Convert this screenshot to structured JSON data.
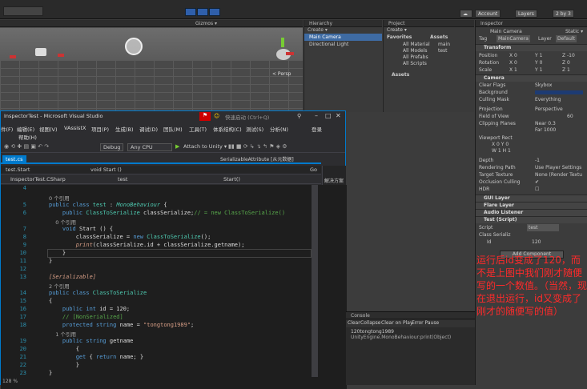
{
  "unity": {
    "layout_btn": "Account",
    "layers_btn": "Layers",
    "layout2_btn": "2 by 3",
    "scene": {
      "gizmos": "Gizmos ▾",
      "persp": "< Persp"
    },
    "hierarchy": {
      "title": "Hierarchy",
      "create": "Create ▾",
      "items": [
        "Main Camera",
        "Directional Light"
      ]
    },
    "project": {
      "title": "Project",
      "create": "Create ▾",
      "favorites": "Favorites",
      "fav_items": [
        "All Material",
        "All Models",
        "All Prefabs",
        "All Scripts"
      ],
      "assets_header": "Assets",
      "assets_items": [
        "main",
        "test"
      ],
      "assets_node": "Assets"
    },
    "inspector": {
      "title": "Inspector",
      "obj_name": "Main Camera",
      "static": "Static ▾",
      "tag_label": "Tag",
      "tag_value": "MainCamera",
      "layer_label": "Layer",
      "layer_value": "Default",
      "transform": "Transform",
      "position": "Position",
      "rotation": "Rotation",
      "scale": "Scale",
      "pos_vals": [
        "X 0",
        "Y 1",
        "Z -10"
      ],
      "rot_vals": [
        "X 0",
        "Y 0",
        "Z 0"
      ],
      "scale_vals": [
        "X 1",
        "Y 1",
        "Z 1"
      ],
      "camera": "Camera",
      "cam_rows": [
        [
          "Clear Flags",
          "Skybox"
        ],
        [
          "Background",
          ""
        ],
        [
          "Culling Mask",
          "Everything"
        ],
        [
          "Projection",
          "Perspective"
        ],
        [
          "Field of View",
          "60"
        ],
        [
          "Clipping Planes",
          "Near 0.3"
        ],
        [
          "",
          "Far 1000"
        ],
        [
          "Viewport Rect",
          ""
        ],
        [
          "",
          "X 0   Y 0"
        ],
        [
          "",
          "W 1   H 1"
        ],
        [
          "Depth",
          "-1"
        ],
        [
          "Rendering Path",
          "Use Player Settings"
        ],
        [
          "Target Texture",
          "None (Render Textu"
        ],
        [
          "Occlusion Culling",
          "✔"
        ],
        [
          "HDR",
          "☐"
        ]
      ],
      "components": [
        "GUI Layer",
        "Flare Layer",
        "Audio Listener",
        "Test (Script)"
      ],
      "script_label": "Script",
      "script_value": "test",
      "class_label": "Class Serializ",
      "id_label": "Id",
      "id_value": "120",
      "add_component": "Add Component"
    },
    "console": {
      "title": "Console",
      "buttons": [
        "Clear",
        "Collapse",
        "Clear on Play",
        "Error Pause"
      ],
      "line1": "120tongtong1989",
      "line2": "UnityEngine.MonoBehaviour:print(Object)"
    }
  },
  "vs": {
    "title": "InspectorTest - Microsoft Visual Studio",
    "quick_launch": "快速启动 (Ctrl+Q)",
    "login": "登录",
    "menu": [
      "件(F)",
      "编辑(E)",
      "视图(V)",
      "VAssistX",
      "项目(P)",
      "生成(B)",
      "调试(D)",
      "团队(M)",
      "工具(T)",
      "体系结构(C)",
      "测试(S)",
      "分析(N)"
    ],
    "menu2": "帮助(H)",
    "debug": "Debug",
    "cpu": "Any CPU",
    "attach": "Attach to Unity ▾",
    "file_tab": "test.cs",
    "serialize_tab": "SerializableAttribute [从元数据]",
    "nav_left": "test.Start",
    "nav_right": "void Start ()",
    "go": "Go",
    "nav2_left": "InspectorTest.CSharp",
    "nav2_mid": "test",
    "nav2_right": "Start()",
    "solution": "解决方案",
    "zoom": "128 %",
    "lines": [
      {
        "n": "4",
        "t": ""
      },
      {
        "n": "",
        "t": "0 个引用",
        "c": "ref"
      },
      {
        "n": "5",
        "t": "public class test : MonoBehaviour {"
      },
      {
        "n": "6",
        "t": "    public ClassToSerialize classSerialize;// = new ClassToSerialize()"
      },
      {
        "n": "",
        "t": "    0 个引用",
        "c": "ref"
      },
      {
        "n": "7",
        "t": "    void Start () {"
      },
      {
        "n": "8",
        "t": "        classSerialize = new ClassToSerialize();"
      },
      {
        "n": "9",
        "t": "        print(classSerialize.id + classSerialize.getname);"
      },
      {
        "n": "10",
        "t": "    }"
      },
      {
        "n": "11",
        "t": "}"
      },
      {
        "n": "12",
        "t": ""
      },
      {
        "n": "13",
        "t": "[Serializable]"
      },
      {
        "n": "",
        "t": "2 个引用",
        "c": "ref"
      },
      {
        "n": "14",
        "t": "public class ClassToSerialize"
      },
      {
        "n": "15",
        "t": "{"
      },
      {
        "n": "16",
        "t": "    public int id = 120;"
      },
      {
        "n": "17",
        "t": "    // [NonSerialized]"
      },
      {
        "n": "18",
        "t": "    protected string name = \"tongtong1989\";"
      },
      {
        "n": "",
        "t": "    1 个引用",
        "c": "ref"
      },
      {
        "n": "19",
        "t": "    public string getname"
      },
      {
        "n": "20",
        "t": "        {"
      },
      {
        "n": "21",
        "t": "        get { return name; }"
      },
      {
        "n": "22",
        "t": "        }"
      },
      {
        "n": "23",
        "t": "}"
      }
    ]
  },
  "annotation": "运行后id变成了120，而不是上图中我们刚才随便写的一个数值。（当然，现在退出运行，id又变成了刚才的随便写的值）"
}
